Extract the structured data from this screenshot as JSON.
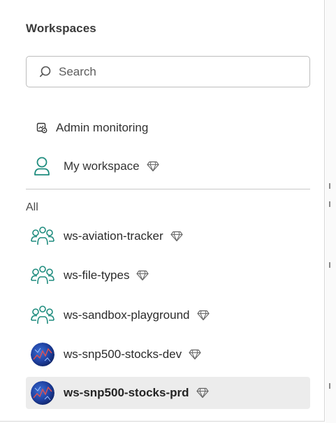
{
  "panel": {
    "title": "Workspaces"
  },
  "search": {
    "placeholder": "Search",
    "value": ""
  },
  "nav": {
    "admin_monitoring": "Admin monitoring",
    "my_workspace": "My workspace"
  },
  "section": {
    "all_label": "All"
  },
  "workspaces": [
    {
      "name": "ws-aviation-tracker",
      "icon": "workspace-group-icon",
      "premium": true,
      "selected": false
    },
    {
      "name": "ws-file-types",
      "icon": "workspace-group-icon",
      "premium": true,
      "selected": false
    },
    {
      "name": "ws-sandbox-playground",
      "icon": "workspace-group-icon",
      "premium": true,
      "selected": false
    },
    {
      "name": "ws-snp500-stocks-dev",
      "icon": "workspace-image-avatar",
      "premium": true,
      "selected": false
    },
    {
      "name": "ws-snp500-stocks-prd",
      "icon": "workspace-image-avatar",
      "premium": true,
      "selected": true
    }
  ],
  "colors": {
    "accent_teal": "#1e8c7e",
    "selected_bg": "#ececec",
    "avatar_blue": "#1e3f9e"
  }
}
